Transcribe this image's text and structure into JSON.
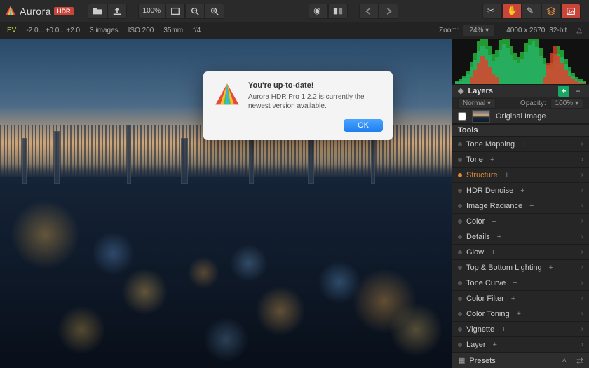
{
  "app": {
    "name": "Aurora",
    "suffix": "HDR"
  },
  "topbar": {
    "zoom_100": "100%"
  },
  "infobar": {
    "ev_label": "EV",
    "ev_values": "-2.0…+0.0…+2.0",
    "image_count": "3 images",
    "iso": "ISO 200",
    "focal": "35mm",
    "aperture": "f/4",
    "zoom_label": "Zoom:",
    "zoom_value": "24%",
    "dimensions": "4000 x 2670",
    "bitdepth": "32-bit"
  },
  "histogram": {
    "icon": "triangle-icon"
  },
  "layers": {
    "title": "Layers",
    "blend_mode": "Normal",
    "opacity_label": "Opacity:",
    "opacity_value": "100%",
    "rows": [
      {
        "name": "Original Image",
        "checked": false
      }
    ]
  },
  "tools": {
    "title": "Tools",
    "items": [
      {
        "label": "Tone Mapping",
        "selected": false
      },
      {
        "label": "Tone",
        "selected": false
      },
      {
        "label": "Structure",
        "selected": true
      },
      {
        "label": "HDR Denoise",
        "selected": false
      },
      {
        "label": "Image Radiance",
        "selected": false
      },
      {
        "label": "Color",
        "selected": false
      },
      {
        "label": "Details",
        "selected": false
      },
      {
        "label": "Glow",
        "selected": false
      },
      {
        "label": "Top & Bottom Lighting",
        "selected": false
      },
      {
        "label": "Tone Curve",
        "selected": false
      },
      {
        "label": "Color Filter",
        "selected": false
      },
      {
        "label": "Color Toning",
        "selected": false
      },
      {
        "label": "Vignette",
        "selected": false
      },
      {
        "label": "Layer",
        "selected": false
      }
    ]
  },
  "presets": {
    "label": "Presets"
  },
  "dialog": {
    "title": "You're up-to-date!",
    "message": "Aurora HDR Pro 1.2.2 is currently the newest version available.",
    "ok": "OK"
  },
  "colors": {
    "accent_orange": "#e08a3a",
    "accent_red": "#c8453a",
    "accent_green": "#1aa765"
  }
}
